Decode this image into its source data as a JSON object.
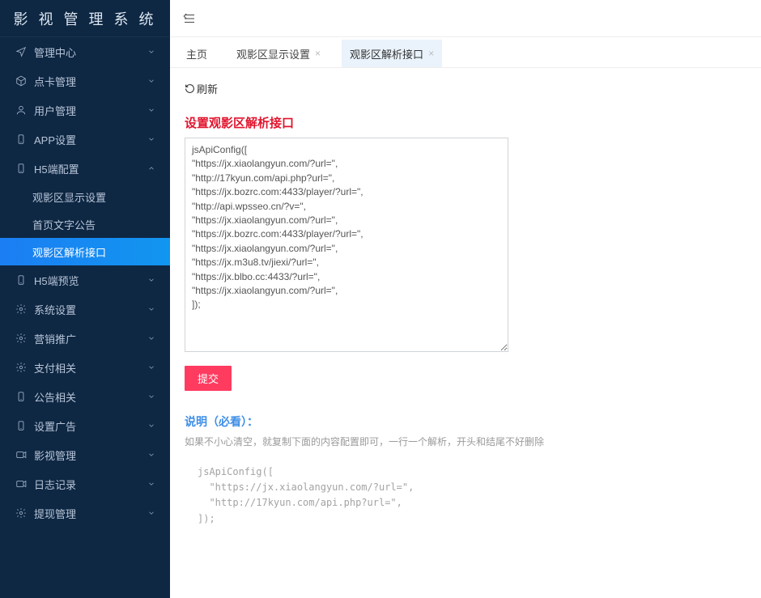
{
  "brand": "影 视 管 理 系 统",
  "sidebar": {
    "items": [
      {
        "icon": "send",
        "label": "管理中心",
        "expanded": false
      },
      {
        "icon": "cube",
        "label": "点卡管理",
        "expanded": false
      },
      {
        "icon": "user",
        "label": "用户管理",
        "expanded": false
      },
      {
        "icon": "phone",
        "label": "APP设置",
        "expanded": false
      },
      {
        "icon": "phone",
        "label": "H5端配置",
        "expanded": true,
        "children": [
          {
            "label": "观影区显示设置",
            "active": false
          },
          {
            "label": "首页文字公告",
            "active": false
          },
          {
            "label": "观影区解析接口",
            "active": true
          }
        ]
      },
      {
        "icon": "phone",
        "label": "H5端预览",
        "expanded": false
      },
      {
        "icon": "gear",
        "label": "系统设置",
        "expanded": false
      },
      {
        "icon": "gear",
        "label": "营销推广",
        "expanded": false
      },
      {
        "icon": "gear",
        "label": "支付相关",
        "expanded": false
      },
      {
        "icon": "phone",
        "label": "公告相关",
        "expanded": false
      },
      {
        "icon": "phone",
        "label": "设置广告",
        "expanded": false
      },
      {
        "icon": "video",
        "label": "影视管理",
        "expanded": false
      },
      {
        "icon": "video",
        "label": "日志记录",
        "expanded": false
      },
      {
        "icon": "gear",
        "label": "提现管理",
        "expanded": false
      }
    ]
  },
  "tabs": {
    "items": [
      {
        "label": "主页",
        "closable": false,
        "active": false
      },
      {
        "label": "观影区显示设置",
        "closable": true,
        "active": false
      },
      {
        "label": "观影区解析接口",
        "closable": true,
        "active": true
      }
    ]
  },
  "content": {
    "refresh_label": "刷新",
    "section_title": "设置观影区解析接口",
    "textarea_value": "jsApiConfig([\n\"https://jx.xiaolangyun.com/?url=\",\n\"http://17kyun.com/api.php?url=\",\n\"https://jx.bozrc.com:4433/player/?url=\",\n\"http://api.wpsseo.cn/?v=\",\n\"https://jx.xiaolangyun.com/?url=\",\n\"https://jx.bozrc.com:4433/player/?url=\",\n\"https://jx.xiaolangyun.com/?url=\",\n\"https://jx.m3u8.tv/jiexi/?url=\",\n\"https://jx.blbo.cc:4433/?url=\",\n\"https://jx.xiaolangyun.com/?url=\",\n]);",
    "submit_label": "提交",
    "note_title": "说明（必看）：",
    "note_desc": "如果不小心清空，就复制下面的内容配置即可，一行一个解析，开头和结尾不好删除",
    "code_block": "jsApiConfig([\n  \"https://jx.xiaolangyun.com/?url=\",\n  \"http://17kyun.com/api.php?url=\",\n]);"
  }
}
